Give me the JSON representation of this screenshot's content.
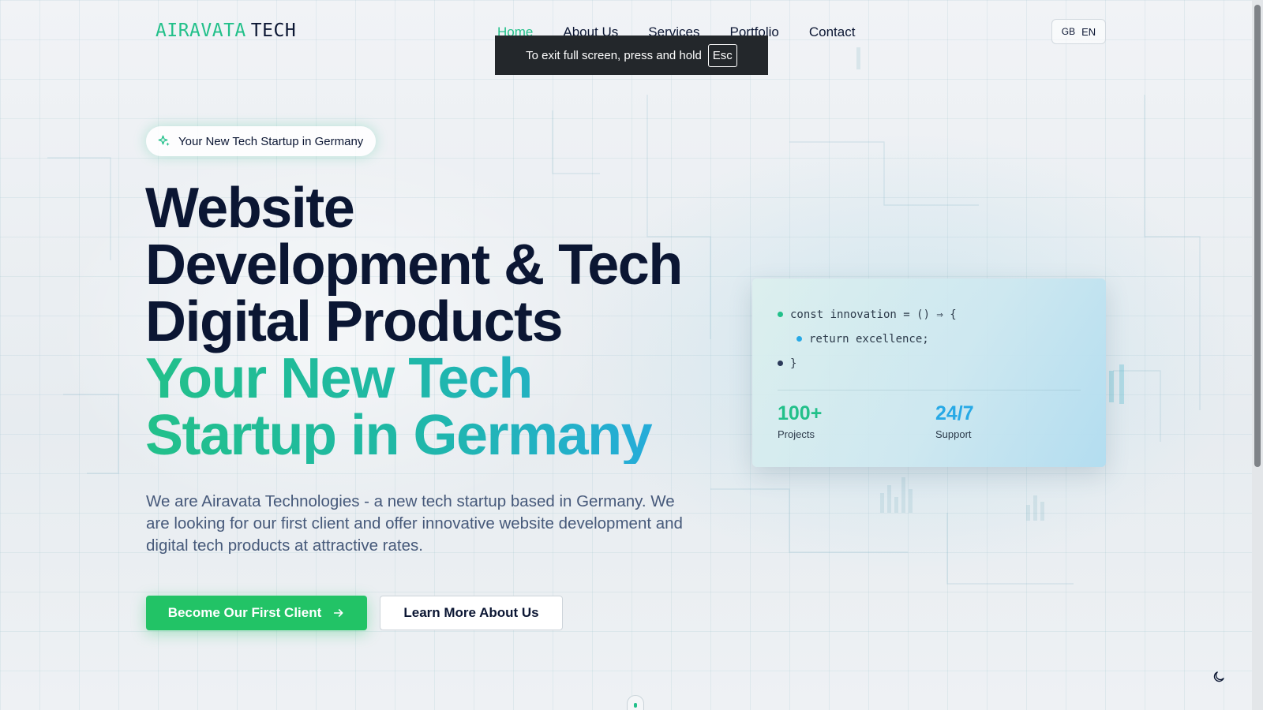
{
  "brand": {
    "part1": "AIRAVATA",
    "part2": "TECH"
  },
  "nav": {
    "items": [
      {
        "label": "Home",
        "active": true
      },
      {
        "label": "About Us",
        "active": false
      },
      {
        "label": "Services",
        "active": false
      },
      {
        "label": "Portfolio",
        "active": false
      },
      {
        "label": "Contact",
        "active": false
      }
    ]
  },
  "language": {
    "flag_text": "GB",
    "code": "EN"
  },
  "fullscreen_toast": {
    "message": "To exit full screen, press and hold",
    "key": "Esc"
  },
  "hero": {
    "badge": "Your New Tech Startup in Germany",
    "headline_lines": [
      "Website",
      "Development & Tech",
      "Digital Products"
    ],
    "headline_accent_lines": [
      "Your New Tech",
      "Startup in Germany"
    ],
    "description": "We are Airavata Technologies - a new tech startup based in Germany. We are looking for our first client and offer innovative website development and digital tech products at attractive rates.",
    "primary_cta": "Become Our First Client",
    "secondary_cta": "Learn More About Us"
  },
  "code_card": {
    "lines": [
      {
        "text": "const innovation = () ⇒ {",
        "dot_color": "#22c08a",
        "indent": false
      },
      {
        "text": "return excellence;",
        "dot_color": "#27a9e6",
        "indent": true
      },
      {
        "text": "}",
        "dot_color": "#2c3a5a",
        "indent": false
      }
    ],
    "stats": [
      {
        "value": "100+",
        "label": "Projects",
        "color": "#22c08a"
      },
      {
        "value": "24/7",
        "label": "Support",
        "color": "#27a9e6"
      }
    ]
  },
  "colors": {
    "accent_green": "#22c08a",
    "accent_blue": "#27a9e6",
    "text_dark": "#0b1633",
    "button_green": "#22c366"
  },
  "icons": [
    "sparkle-icon",
    "arrow-right-icon",
    "moon-icon"
  ]
}
